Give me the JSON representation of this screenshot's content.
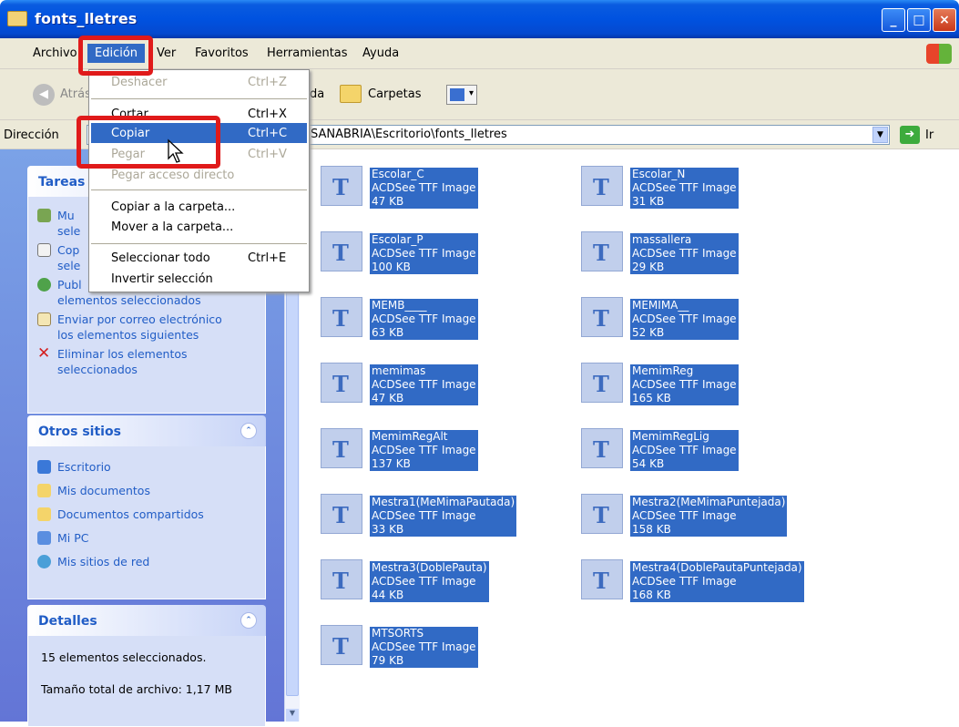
{
  "window": {
    "title": "fonts_lletres"
  },
  "menubar": {
    "items": [
      "Archivo",
      "Edición",
      "Ver",
      "Favoritos",
      "Herramientas",
      "Ayuda"
    ]
  },
  "toolbar": {
    "back_label": "Atrás",
    "search_fragment": "da",
    "folders_label": "Carpetas"
  },
  "address": {
    "label": "Dirección",
    "path": "SANABRIA\\Escritorio\\fonts_lletres",
    "go_label": "Ir"
  },
  "edit_menu": {
    "items": [
      {
        "label": "Deshacer",
        "shortcut": "Ctrl+Z"
      },
      {
        "label": "Cortar",
        "shortcut": "Ctrl+X"
      },
      {
        "label": "Copiar",
        "shortcut": "Ctrl+C"
      },
      {
        "label": "Pegar",
        "shortcut": "Ctrl+V"
      },
      {
        "label": "Pegar acceso directo",
        "shortcut": ""
      },
      {
        "label": "Copiar a la carpeta...",
        "shortcut": ""
      },
      {
        "label": "Mover a la carpeta...",
        "shortcut": ""
      },
      {
        "label": "Seleccionar todo",
        "shortcut": "Ctrl+E"
      },
      {
        "label": "Invertir selección",
        "shortcut": ""
      }
    ]
  },
  "tasks": {
    "title": "Tareas",
    "items": [
      {
        "line1": "Mu",
        "line2": "sele"
      },
      {
        "line1": "Cop",
        "line2": "sele"
      },
      {
        "line1": "Publ",
        "line2": "elementos seleccionados"
      },
      {
        "line1": "Enviar por correo electrónico",
        "line2": "los elementos siguientes"
      },
      {
        "line1": "Eliminar los elementos",
        "line2": "seleccionados"
      }
    ]
  },
  "other_places": {
    "title": "Otros sitios",
    "items": [
      "Escritorio",
      "Mis documentos",
      "Documentos compartidos",
      "Mi PC",
      "Mis sitios de red"
    ]
  },
  "details": {
    "title": "Detalles",
    "count": "15 elementos seleccionados.",
    "size": "Tamaño total de archivo: 1,17 MB"
  },
  "files": [
    {
      "name": "Escolar_C",
      "type": "ACDSee TTF Image",
      "size": "47 KB"
    },
    {
      "name": "Escolar_N",
      "type": "ACDSee TTF Image",
      "size": "31 KB"
    },
    {
      "name": "Escolar_P",
      "type": "ACDSee TTF Image",
      "size": "100 KB"
    },
    {
      "name": "massallera",
      "type": "ACDSee TTF Image",
      "size": "29 KB"
    },
    {
      "name": "MEMB____",
      "type": "ACDSee TTF Image",
      "size": "63 KB"
    },
    {
      "name": "MEMIMA__",
      "type": "ACDSee TTF Image",
      "size": "52 KB"
    },
    {
      "name": "memimas",
      "type": "ACDSee TTF Image",
      "size": "47 KB"
    },
    {
      "name": "MemimReg",
      "type": "ACDSee TTF Image",
      "size": "165 KB"
    },
    {
      "name": "MemimRegAlt",
      "type": "ACDSee TTF Image",
      "size": "137 KB"
    },
    {
      "name": "MemimRegLig",
      "type": "ACDSee TTF Image",
      "size": "54 KB"
    },
    {
      "name": "Mestra1(MeMimaPautada)",
      "type": "ACDSee TTF Image",
      "size": "33 KB"
    },
    {
      "name": "Mestra2(MeMimaPuntejada)",
      "type": "ACDSee TTF Image",
      "size": "158 KB"
    },
    {
      "name": "Mestra3(DoblePauta)",
      "type": "ACDSee TTF Image",
      "size": "44 KB"
    },
    {
      "name": "Mestra4(DoblePautaPuntejada)",
      "type": "ACDSee TTF Image",
      "size": "168 KB"
    },
    {
      "name": "MTSORTS",
      "type": "ACDSee TTF Image",
      "size": "79 KB"
    }
  ],
  "file_icon_glyph": "T",
  "colors": {
    "selection": "#316ac5",
    "highlight_box": "#e01a1a",
    "titlebar": "#0052e0"
  }
}
